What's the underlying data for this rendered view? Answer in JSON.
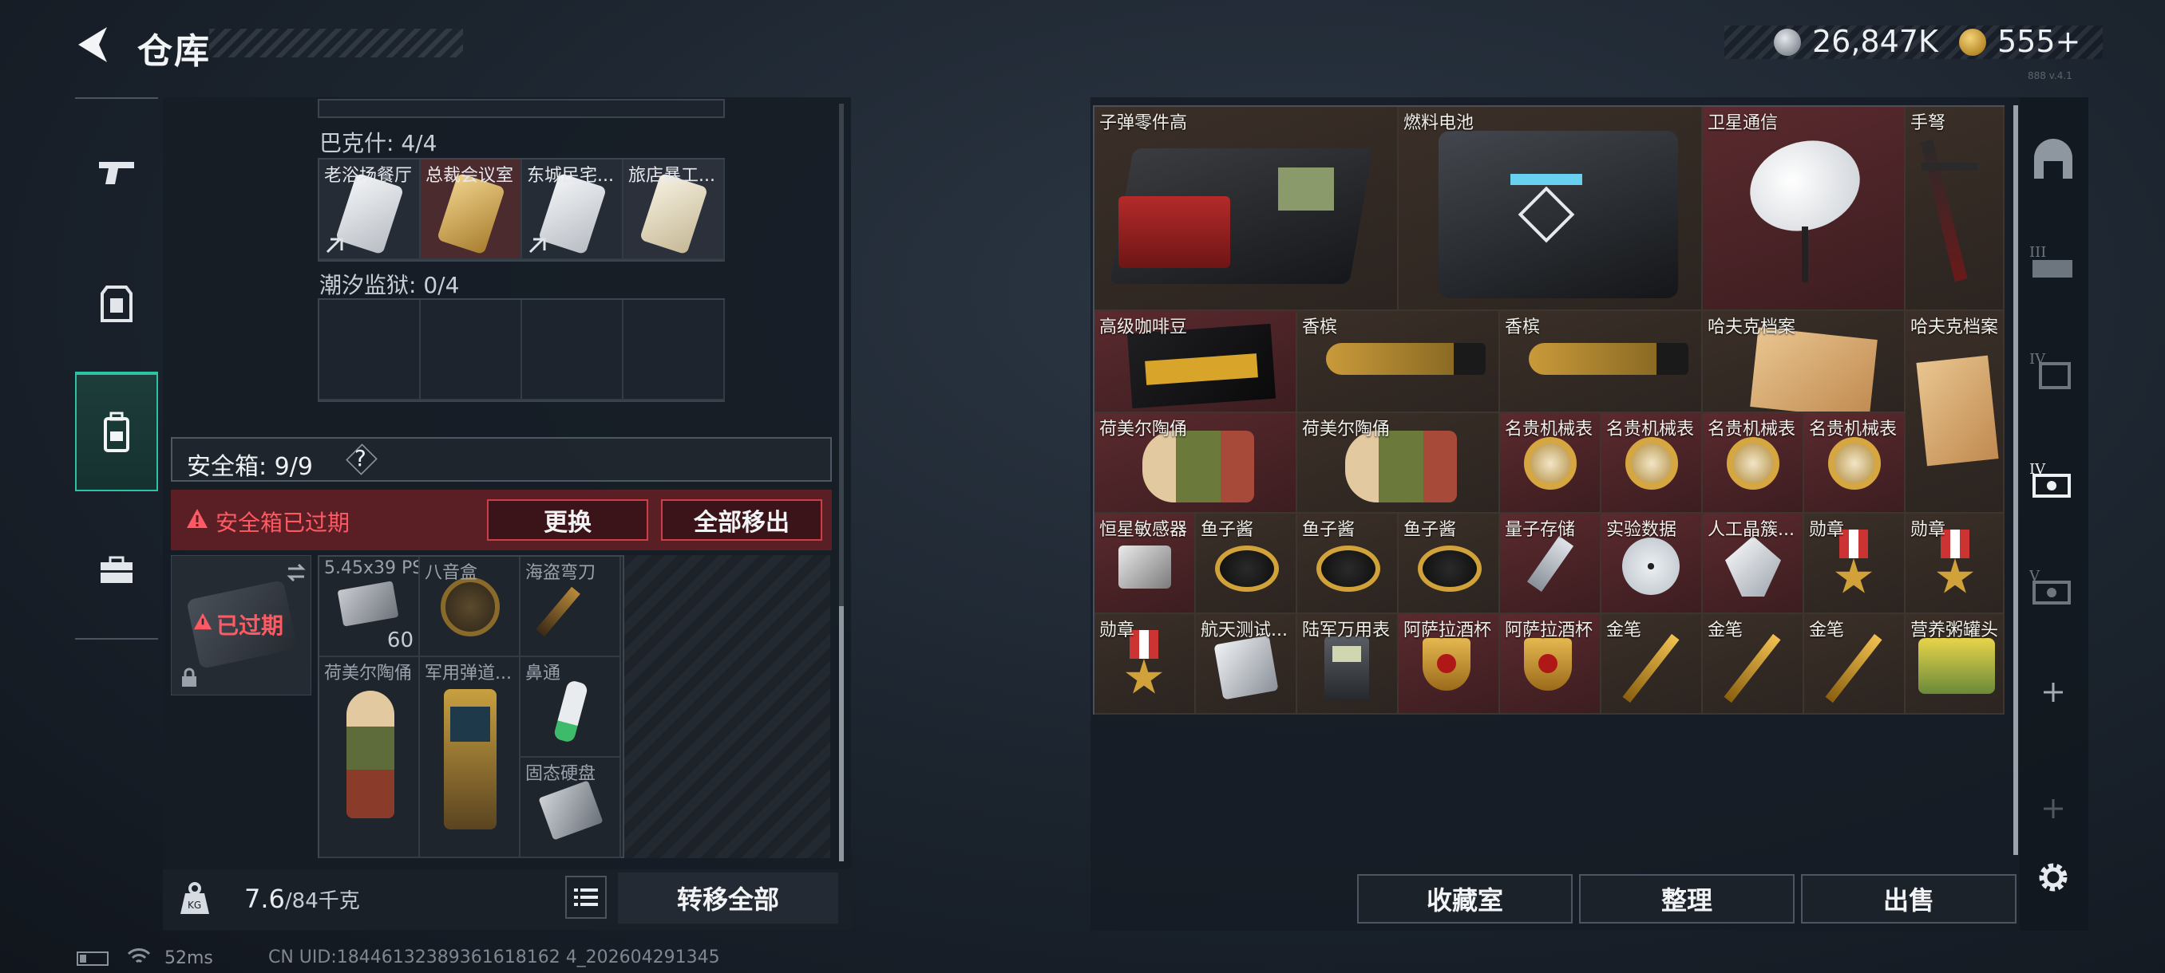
{
  "header": {
    "title": "仓库",
    "currency1": "26,847K",
    "currency2": "555+",
    "version": "888 v.4.1"
  },
  "left_nav": {
    "items": [
      "weapon-icon",
      "armor-icon",
      "backpack-icon",
      "toolbox-icon"
    ],
    "selected": "backpack-icon"
  },
  "collections": [
    {
      "label": "巴克什: 4/4",
      "cells": [
        "老浴场餐厅",
        "总裁会议室",
        "东城民宅...",
        "旅店暴工..."
      ]
    },
    {
      "label": "潮汐监狱: 0/4",
      "cells": [
        "",
        "",
        "",
        ""
      ]
    }
  ],
  "safe_box": {
    "label": "安全箱: 9/9",
    "help": "?",
    "expired_warning": "安全箱已过期",
    "replace_label": "更换",
    "remove_all_label": "全部移出",
    "expired_tag": "已过期",
    "items": [
      {
        "name": "5.45x39 PS",
        "count": "60"
      },
      {
        "name": "八音盒"
      },
      {
        "name": "海盗弯刀"
      },
      {
        "name": "荷美尔陶俑"
      },
      {
        "name": "军用弹道..."
      },
      {
        "name": "鼻通"
      },
      {
        "name": "固态硬盘"
      }
    ]
  },
  "bottom": {
    "weight_current": "7.6",
    "weight_max": "/84千克",
    "transfer_all_label": "转移全部"
  },
  "warehouse": {
    "items": [
      {
        "name": "子弹零件高"
      },
      {
        "name": "燃料电池"
      },
      {
        "name": "卫星通信"
      },
      {
        "name": "手弩"
      },
      {
        "name": "高级咖啡豆"
      },
      {
        "name": "香槟"
      },
      {
        "name": "香槟"
      },
      {
        "name": "哈夫克档案"
      },
      {
        "name": "哈夫克档案"
      },
      {
        "name": "荷美尔陶俑"
      },
      {
        "name": "荷美尔陶俑"
      },
      {
        "name": "名贵机械表"
      },
      {
        "name": "名贵机械表"
      },
      {
        "name": "名贵机械表"
      },
      {
        "name": "名贵机械表"
      },
      {
        "name": "恒星敏感器"
      },
      {
        "name": "鱼子酱"
      },
      {
        "name": "鱼子酱"
      },
      {
        "name": "鱼子酱"
      },
      {
        "name": "量子存储"
      },
      {
        "name": "实验数据"
      },
      {
        "name": "人工晶簇..."
      },
      {
        "name": "勋章"
      },
      {
        "name": "勋章"
      },
      {
        "name": "勋章"
      },
      {
        "name": "航天测试..."
      },
      {
        "name": "陆军万用表"
      },
      {
        "name": "阿萨拉酒杯"
      },
      {
        "name": "阿萨拉酒杯"
      },
      {
        "name": "金笔"
      },
      {
        "name": "金笔"
      },
      {
        "name": "金笔"
      },
      {
        "name": "营养粥罐头"
      }
    ],
    "buttons": {
      "collection": "收藏室",
      "sort": "整理",
      "sell": "出售"
    }
  },
  "right_nav": {
    "items": [
      "bunker-icon",
      "storage-iii-icon",
      "storage-iv-icon",
      "storage-iv-selected-icon",
      "storage-v-icon",
      "add-icon",
      "add-icon"
    ]
  },
  "status": {
    "ping": "52ms",
    "uid": "CN UID:18446132389361618162 4_202604291345"
  },
  "colors": {
    "accent": "#2ec1a2",
    "warning": "#e0424c",
    "gold": "#d9a53a"
  }
}
